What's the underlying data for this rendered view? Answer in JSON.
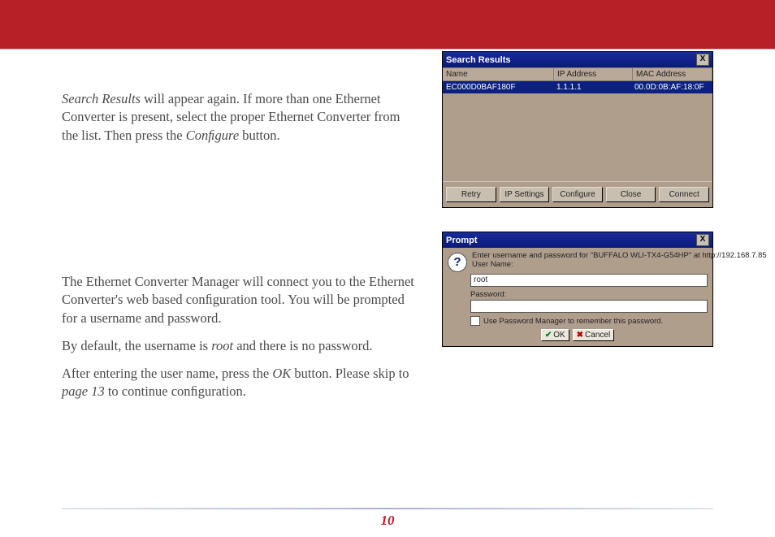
{
  "page_number": "10",
  "section1": {
    "text_parts": {
      "a": "Search Results",
      "b": " will appear again.  If more than one Ethernet Converter is present, select the proper Ethernet Converter from the list.  Then press the ",
      "c": "Conﬁgure",
      "d": " button."
    }
  },
  "section2": {
    "p1": "The Ethernet Converter Manager will connect you to the Ethernet Converter's web based conﬁguration tool.  You will be prompted for a username and password.",
    "p2_parts": {
      "a": "By default, the username is ",
      "b": "root",
      "c": " and there is no password."
    },
    "p3_parts": {
      "a": "After entering the user name, press the ",
      "b": "OK",
      "c": " button.  Please skip to ",
      "d": "page 13",
      "e": " to continue conﬁguration."
    }
  },
  "fig1": {
    "title": "Search Results",
    "close": "X",
    "headers": {
      "name": "Name",
      "ip": "IP Address",
      "mac": "MAC Address"
    },
    "row": {
      "name": "EC000D0BAF180F",
      "ip": "1.1.1.1",
      "mac": "00.0D:0B:AF:18:0F"
    },
    "buttons": {
      "retry": "Retry",
      "ip_settings": "IP Settings",
      "configure": "Configure",
      "close": "Close",
      "connect": "Connect"
    }
  },
  "fig2": {
    "title": "Prompt",
    "close": "X",
    "line1": "Enter username and password for \"BUFFALO WLI-TX4-G54HP\" at http://192.168.7.85",
    "username_label": "User Name:",
    "username_value": "root",
    "password_label": "Password:",
    "password_value": "",
    "remember": "Use Password Manager to remember this password.",
    "ok": "OK",
    "cancel": "Cancel"
  }
}
